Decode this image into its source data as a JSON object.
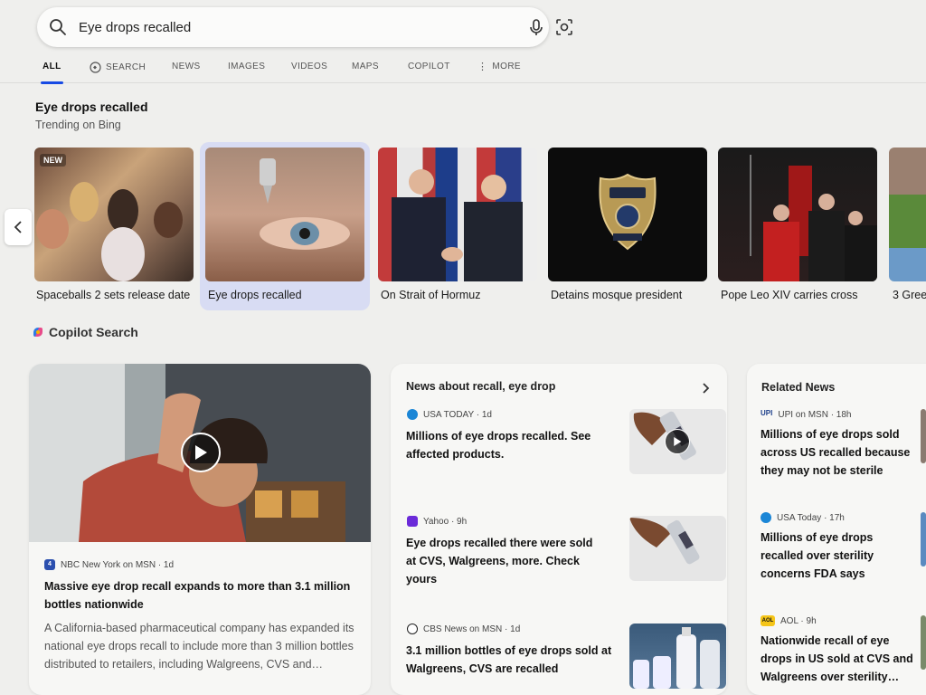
{
  "search": {
    "query": "Eye drops recalled"
  },
  "tabs": [
    {
      "label": "ALL"
    },
    {
      "label": "SEARCH"
    },
    {
      "label": "NEWS"
    },
    {
      "label": "IMAGES"
    },
    {
      "label": "VIDEOS"
    },
    {
      "label": "MAPS"
    },
    {
      "label": "COPILOT"
    },
    {
      "label": "MORE"
    }
  ],
  "trending": {
    "title": "Eye drops recalled",
    "subtitle": "Trending on Bing",
    "new_badge": "NEW",
    "cards": [
      {
        "label": "Spaceballs 2 sets release date"
      },
      {
        "label": "Eye drops recalled"
      },
      {
        "label": "On Strait of Hormuz"
      },
      {
        "label": "Detains mosque president"
      },
      {
        "label": "Pope Leo XIV carries cross"
      },
      {
        "label": "3 Gree"
      }
    ]
  },
  "copilot": {
    "label": "Copilot Search"
  },
  "main_story": {
    "source": "NBC New York on MSN · 1d",
    "headline": "Massive eye drop recall expands to more than 3.1 million bottles nationwide",
    "snippet": "A California-based pharmaceutical company has expanded its national eye drops recall to include more than 3 million bottles distributed to retailers, including Walgreens, CVS and…"
  },
  "news": {
    "title": "News about recall, eye drop",
    "items": [
      {
        "source": "USA TODAY · 1d",
        "headline": "Millions of eye drops recalled. See affected products."
      },
      {
        "source": "Yahoo · 9h",
        "headline": "Eye drops recalled there were sold at CVS, Walgreens, more. Check yours"
      },
      {
        "source": "CBS News on MSN · 1d",
        "headline": "3.1 million bottles of eye drops sold at Walgreens, CVS are recalled"
      }
    ]
  },
  "related": {
    "title": "Related News",
    "items": [
      {
        "source": "UPI on MSN · 18h",
        "headline": "Millions of eye drops sold across US recalled because they may not be sterile"
      },
      {
        "source": "USA Today · 17h",
        "headline": "Millions of eye drops recalled over sterility concerns FDA says"
      },
      {
        "source": "AOL · 9h",
        "headline": "Nationwide recall of eye drops in US sold at CVS and Walgreens over sterility…"
      }
    ]
  },
  "logos": {
    "nbc": "4",
    "upi": "UPI",
    "aol": "AOL"
  },
  "colors": {
    "accent": "#174ae4",
    "selected_card": "#d8dcf3"
  }
}
